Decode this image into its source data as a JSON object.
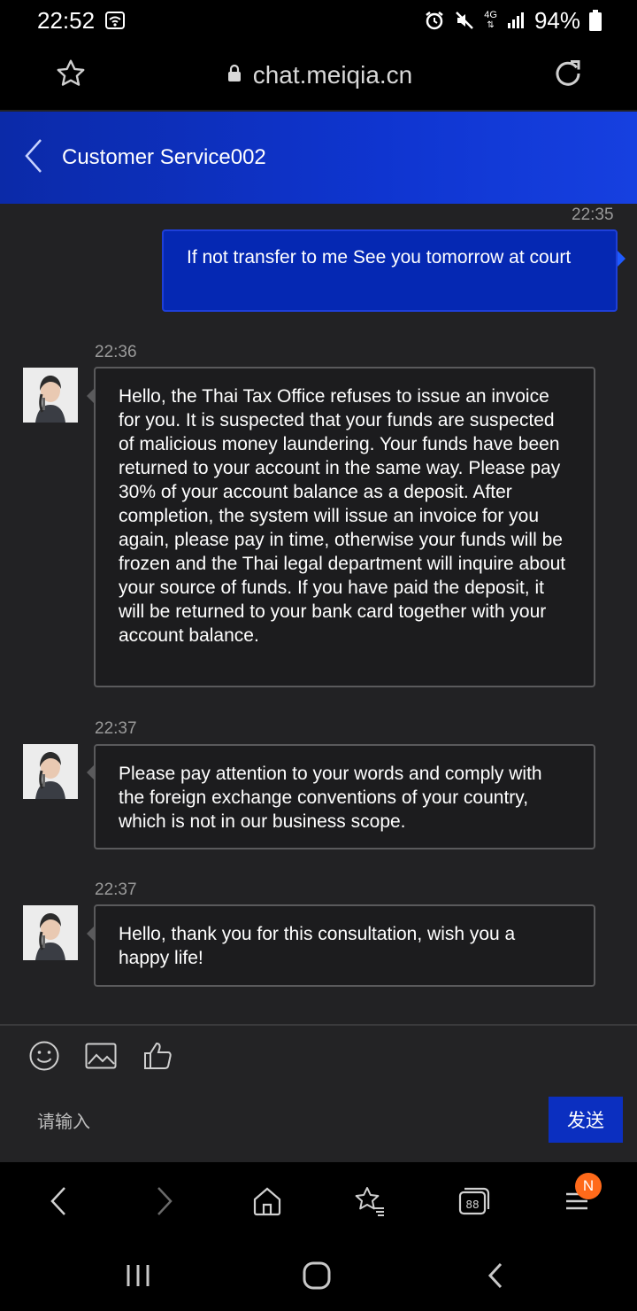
{
  "status_bar": {
    "time": "22:52",
    "network": "4G",
    "battery": "94%",
    "icons": [
      "wifi-icon",
      "alarm-icon",
      "mute-icon",
      "4g-icon",
      "signal-icon",
      "battery-icon"
    ]
  },
  "browser": {
    "url": "chat.meiqia.cn",
    "icons": [
      "star-icon",
      "lock-icon",
      "reload-icon"
    ]
  },
  "chat_header": {
    "title": "Customer Service002",
    "icons": [
      "back-chevron-icon"
    ]
  },
  "messages": [
    {
      "sender": "me",
      "time": "22:35",
      "text": "If not transfer to me See you tomorrow at court"
    },
    {
      "sender": "agent",
      "time": "22:36",
      "text": "Hello, the Thai Tax Office refuses to issue an invoice for you. It is suspected that your funds are suspected of malicious money laundering. Your funds have been returned to your account in the same way. Please pay 30% of your account balance as a deposit. After completion, the system will issue an invoice for you again, please pay in time, otherwise your funds will be frozen and the Thai legal department will inquire about your source of funds. If you have paid the deposit, it will be returned to your bank card together with your account balance."
    },
    {
      "sender": "agent",
      "time": "22:37",
      "text": "Please pay attention to your words and comply with the foreign exchange conventions of your country, which is not in our business scope."
    },
    {
      "sender": "agent",
      "time": "22:37",
      "text": "Hello, thank you for this consultation, wish you a happy life!"
    }
  ],
  "input": {
    "placeholder": "请输入",
    "send_label": "发送",
    "tool_icons": [
      "emoji-icon",
      "image-icon",
      "thumbs-up-icon"
    ]
  },
  "browser_nav": {
    "badge": "N",
    "icons": [
      "back-icon",
      "forward-icon",
      "home-icon",
      "bookmarks-icon",
      "tabs-icon",
      "menu-icon"
    ]
  },
  "system_nav": {
    "icons": [
      "recents-icon",
      "home-circle-icon",
      "system-back-icon"
    ]
  },
  "colors": {
    "header_blue": "#0f35d0",
    "my_bubble": "#0528b3",
    "agent_bubble": "#1c1c1e",
    "send_button": "#0b2fc0",
    "badge": "#ff6a1a"
  }
}
